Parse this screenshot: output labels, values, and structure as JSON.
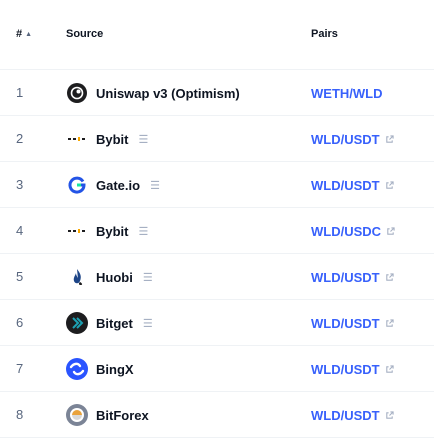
{
  "header": {
    "rank_label": "#",
    "source_label": "Source",
    "pairs_label": "Pairs"
  },
  "rows": [
    {
      "rank": "1",
      "exchange": "Uniswap v3 (Optimism)",
      "pair": "WETH/WLD",
      "logo": "uniswap-icon",
      "menu": false
    },
    {
      "rank": "2",
      "exchange": "Bybit",
      "pair": "WLD/USDT",
      "logo": "bybit-icon",
      "menu": true
    },
    {
      "rank": "3",
      "exchange": "Gate.io",
      "pair": "WLD/USDT",
      "logo": "gateio-icon",
      "menu": true
    },
    {
      "rank": "4",
      "exchange": "Bybit",
      "pair": "WLD/USDC",
      "logo": "bybit-icon",
      "menu": true
    },
    {
      "rank": "5",
      "exchange": "Huobi",
      "pair": "WLD/USDT",
      "logo": "huobi-icon",
      "menu": true
    },
    {
      "rank": "6",
      "exchange": "Bitget",
      "pair": "WLD/USDT",
      "logo": "bitget-icon",
      "menu": true
    },
    {
      "rank": "7",
      "exchange": "BingX",
      "pair": "WLD/USDT",
      "logo": "bingx-icon",
      "menu": false
    },
    {
      "rank": "8",
      "exchange": "BitForex",
      "pair": "WLD/USDT",
      "logo": "bitforex-icon",
      "menu": false
    }
  ],
  "colors": {
    "link": "#3861fb",
    "text": "#0d1421",
    "muted": "#58667e",
    "divider": "#eff2f5"
  }
}
